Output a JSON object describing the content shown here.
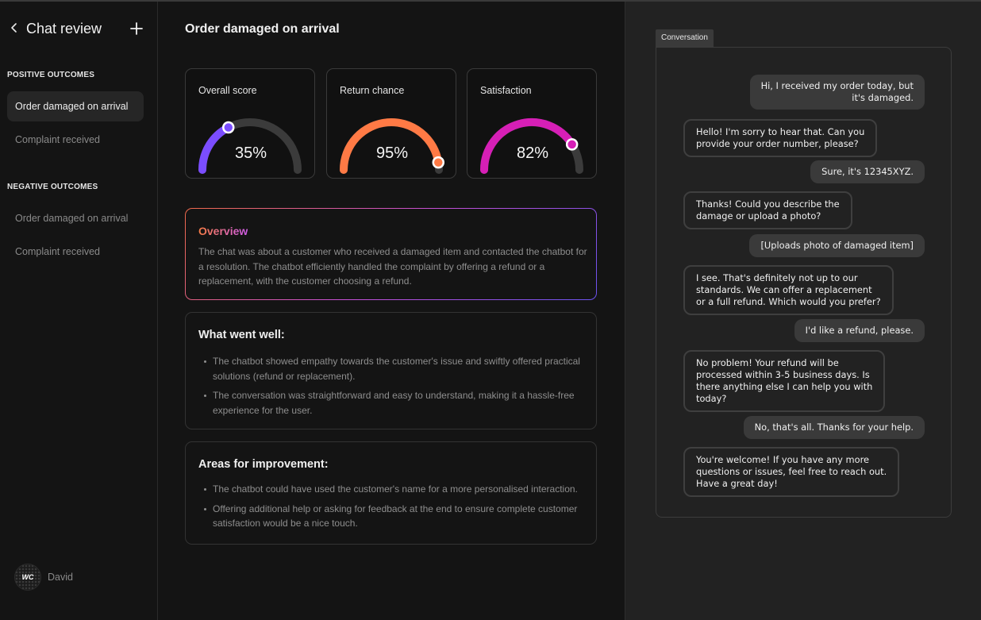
{
  "sidebar": {
    "title": "Chat review",
    "sections": [
      {
        "label": "POSITIVE OUTCOMES",
        "items": [
          {
            "label": "Order damaged on arrival",
            "active": true
          },
          {
            "label": "Complaint received",
            "active": false
          }
        ]
      },
      {
        "label": "NEGATIVE OUTCOMES",
        "items": [
          {
            "label": "Order damaged on arrival",
            "active": false
          },
          {
            "label": "Complaint received",
            "active": false
          }
        ]
      }
    ],
    "user": {
      "name": "David",
      "avatar_text": "WC"
    }
  },
  "main": {
    "title": "Order damaged on arrival",
    "gauges": [
      {
        "label": "Overall score",
        "value": 0.35,
        "display": "35%",
        "color": "#7b4dff"
      },
      {
        "label": "Return chance",
        "value": 0.95,
        "display": "95%",
        "color": "#ff7a45"
      },
      {
        "label": "Satisfaction",
        "value": 0.82,
        "display": "82%",
        "color": "#d61fb6"
      }
    ],
    "overview": {
      "title": "Overview",
      "text": "The chat was about a customer who received a damaged item and contacted the chatbot for a resolution. The chatbot efficiently handled the complaint by offering a refund or a replacement, with the customer choosing a refund."
    },
    "went_well": {
      "title": "What went well:",
      "items": [
        "The chatbot showed empathy towards the customer's issue and swiftly offered practical solutions (refund or replacement).",
        "The conversation was straightforward and easy to understand, making it a hassle-free experience for the user."
      ]
    },
    "improvement": {
      "title": "Areas for improvement:",
      "items": [
        "The chatbot could have used the customer's name for a more personalised interaction.",
        "Offering additional help or asking for feedback at the end to ensure complete customer satisfaction would be a nice touch."
      ]
    }
  },
  "conversation": {
    "tab_label": "Conversation",
    "messages": [
      {
        "role": "user",
        "lines": [
          "Hi, I received my order today, but",
          "it's damaged."
        ]
      },
      {
        "role": "bot",
        "lines": [
          "Hello! I'm sorry to hear that. Can you",
          "provide your order number, please?"
        ]
      },
      {
        "role": "user",
        "lines": [
          "Sure, it's 12345XYZ."
        ]
      },
      {
        "role": "bot",
        "lines": [
          "Thanks! Could you describe the",
          "damage or upload a photo?"
        ]
      },
      {
        "role": "user",
        "lines": [
          "[Uploads photo of damaged item]"
        ]
      },
      {
        "role": "bot",
        "lines": [
          "I see. That's definitely not up to our",
          "standards. We can offer a replacement",
          "or a full refund. Which would you prefer?"
        ]
      },
      {
        "role": "user",
        "lines": [
          "I'd like a refund, please."
        ]
      },
      {
        "role": "bot",
        "lines": [
          "No problem! Your refund will be",
          "processed within 3-5 business days. Is",
          "there anything else I can help you with",
          "today?"
        ]
      },
      {
        "role": "user",
        "lines": [
          "No, that's all. Thanks for your help."
        ]
      },
      {
        "role": "bot",
        "lines": [
          "You're welcome! If you have any more",
          "questions or issues, feel free to reach out.",
          "Have a great day!"
        ]
      }
    ]
  }
}
